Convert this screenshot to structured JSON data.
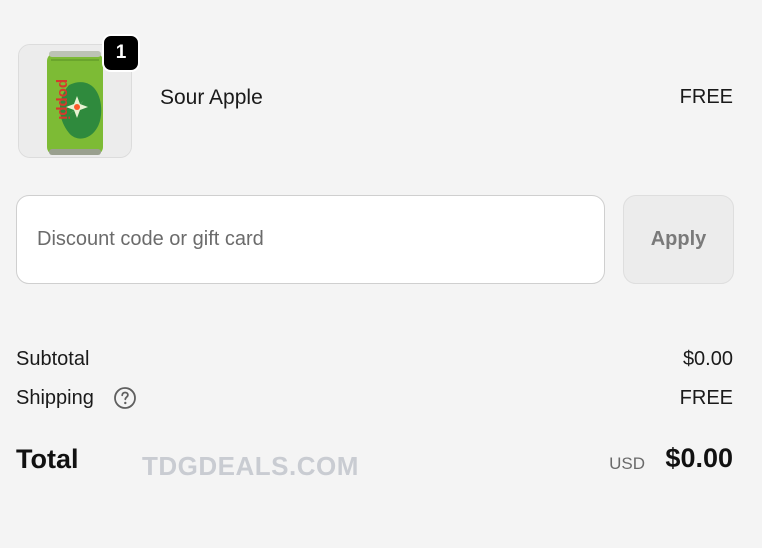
{
  "line_item": {
    "image_label": "poppi",
    "quantity": "1",
    "name": "Sour Apple",
    "price": "FREE"
  },
  "discount": {
    "placeholder": "Discount code or gift card",
    "apply_label": "Apply"
  },
  "summary": {
    "subtotal_label": "Subtotal",
    "subtotal_value": "$0.00",
    "shipping_label": "Shipping",
    "shipping_value": "FREE",
    "total_label": "Total",
    "currency": "USD",
    "total_value": "$0.00"
  },
  "watermark": "TDGDEALS.COM",
  "icons": {
    "help": "question-circle-icon"
  },
  "colors": {
    "can_green": "#7dbb35",
    "badge": "#000000",
    "page_bg": "#f4f4f4"
  }
}
